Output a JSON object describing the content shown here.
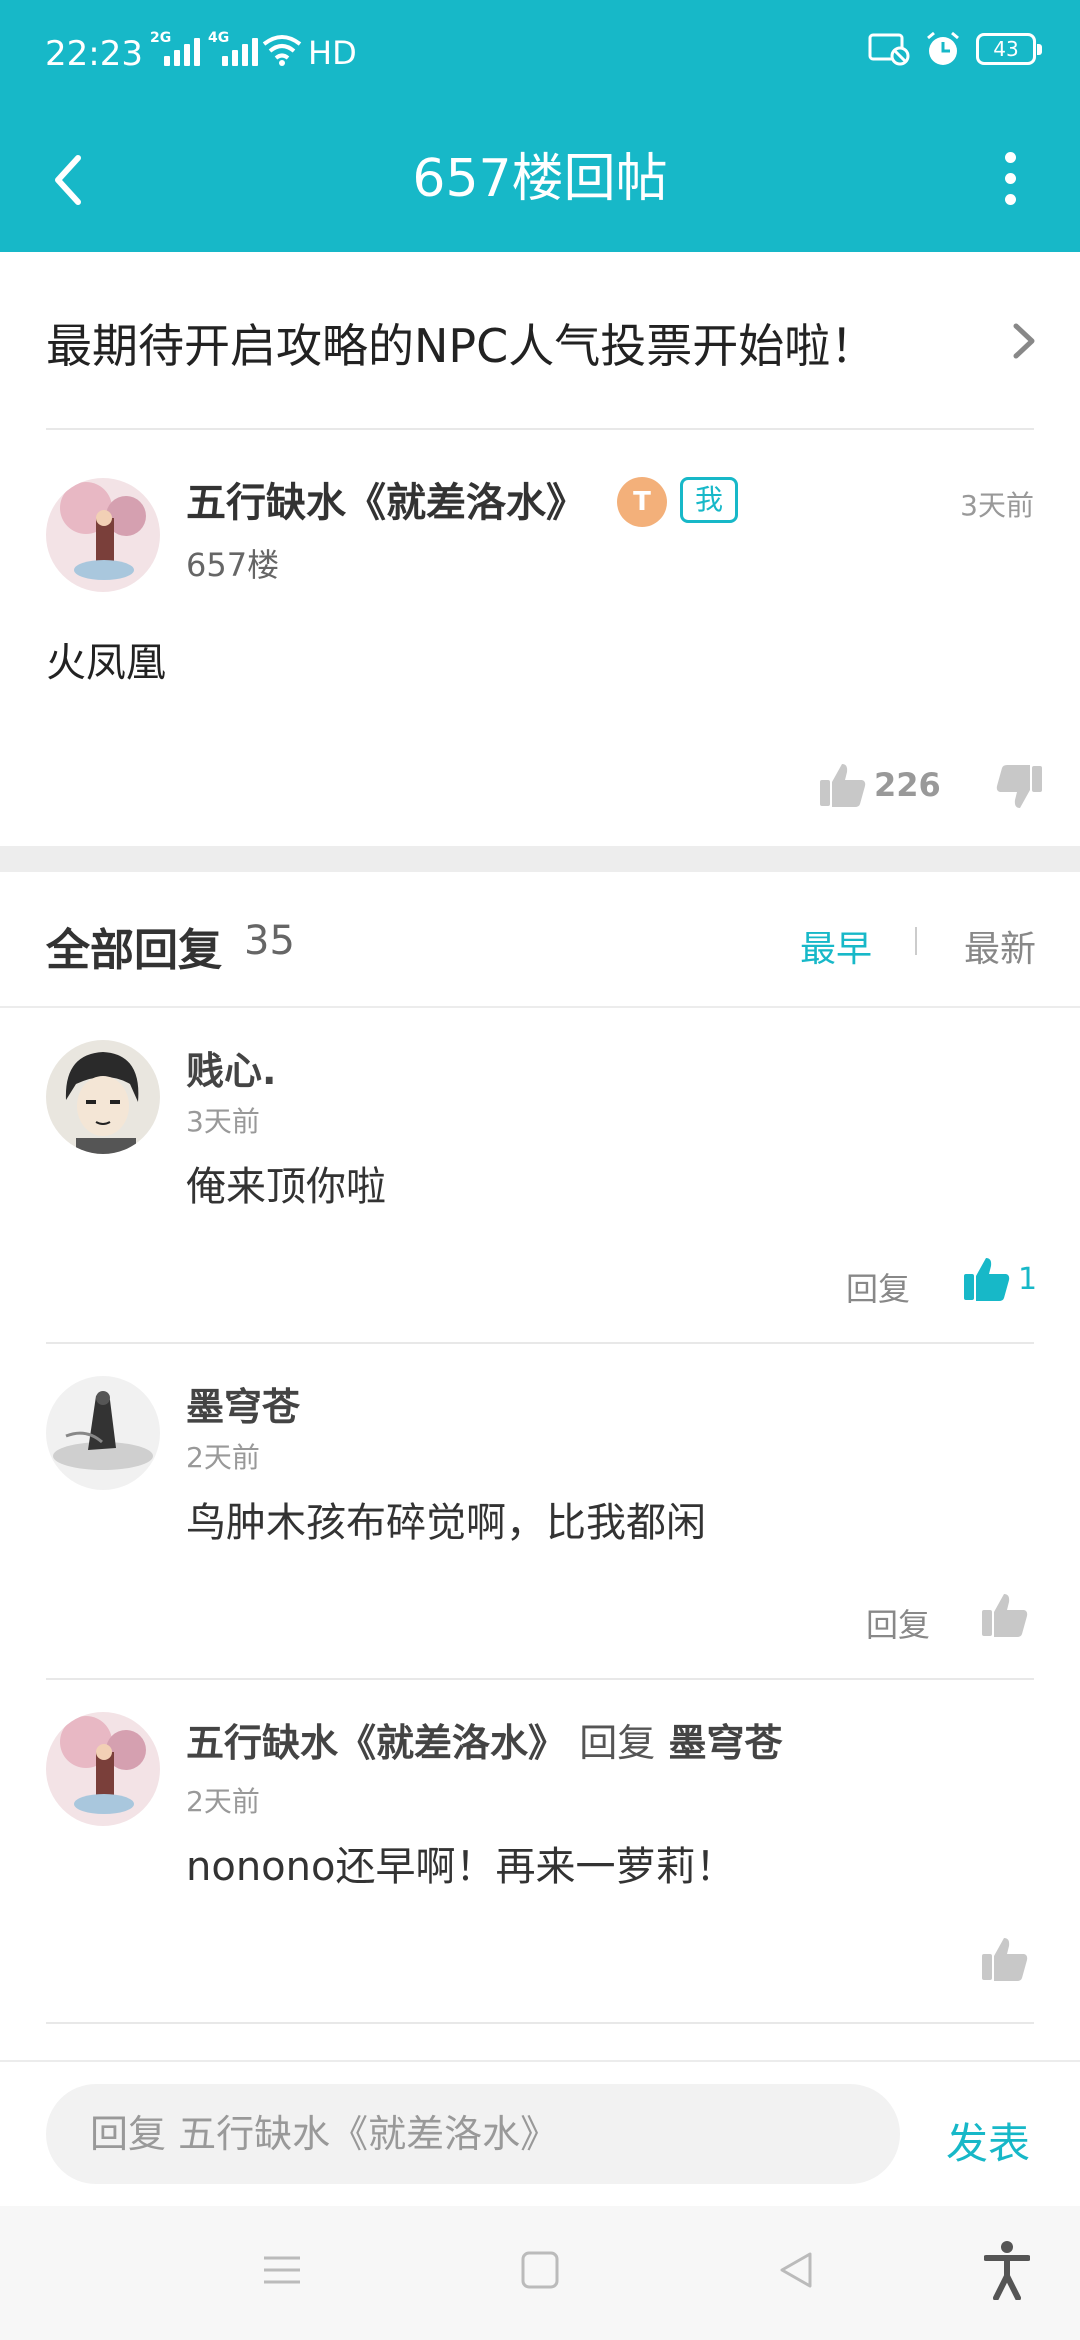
{
  "status_bar": {
    "time": "22:23",
    "net1": "2G",
    "net2": "4G",
    "hd": "HD",
    "battery": "43"
  },
  "nav": {
    "title": "657楼回帖"
  },
  "announcement": {
    "text": "最期待开启攻略的NPC人气投票开始啦！"
  },
  "post": {
    "author": "五行缺水《就差洛水》",
    "level_badge": "T",
    "me_badge": "我",
    "floor": "657楼",
    "time": "3天前",
    "body": "火凤凰",
    "likes": "226"
  },
  "replies_header": {
    "title": "全部回复",
    "count": "35",
    "sort_earliest": "最早",
    "sort_latest": "最新"
  },
  "replies": [
    {
      "name": "贱心.",
      "time": "3天前",
      "text": "俺来顶你啦",
      "reply_label": "回复",
      "likes": "1"
    },
    {
      "name": "墨穹苍",
      "time": "2天前",
      "text": "鸟肿木孩布碎觉啊，比我都闲",
      "reply_label": "回复"
    },
    {
      "name": "五行缺水《就差洛水》",
      "reply_word": "回复",
      "reply_to": "墨穹苍",
      "time": "2天前",
      "text": "nonono还早啊！再来一萝莉！"
    }
  ],
  "composer": {
    "placeholder": "回复 五行缺水《就差洛水》",
    "send_label": "发表"
  },
  "colors": {
    "accent": "#17b8c8",
    "background": "#ffffff",
    "gap": "#ededed"
  }
}
